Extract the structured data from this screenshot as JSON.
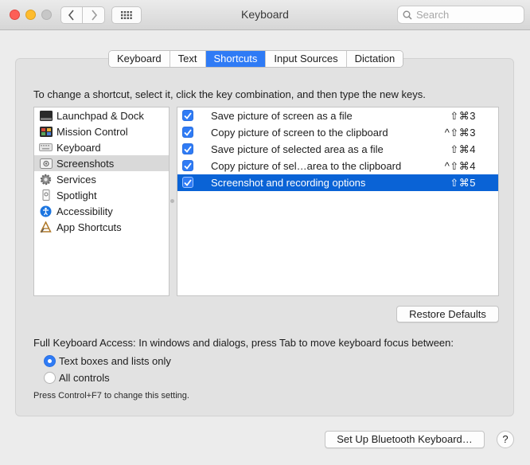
{
  "window": {
    "title": "Keyboard"
  },
  "search": {
    "placeholder": "Search"
  },
  "tabs": [
    {
      "label": "Keyboard"
    },
    {
      "label": "Text"
    },
    {
      "label": "Shortcuts"
    },
    {
      "label": "Input Sources"
    },
    {
      "label": "Dictation"
    }
  ],
  "active_tab": "Shortcuts",
  "instruction": "To change a shortcut, select it, click the key combination, and then type the new keys.",
  "categories": [
    {
      "label": "Launchpad & Dock",
      "icon": "launchpad-dock-icon"
    },
    {
      "label": "Mission Control",
      "icon": "mission-control-icon"
    },
    {
      "label": "Keyboard",
      "icon": "keyboard-icon"
    },
    {
      "label": "Screenshots",
      "icon": "screenshots-icon"
    },
    {
      "label": "Services",
      "icon": "gear-icon"
    },
    {
      "label": "Spotlight",
      "icon": "spotlight-icon"
    },
    {
      "label": "Accessibility",
      "icon": "accessibility-icon"
    },
    {
      "label": "App Shortcuts",
      "icon": "app-shortcuts-icon"
    }
  ],
  "selected_category": "Screenshots",
  "shortcuts": [
    {
      "label": "Save picture of screen as a file",
      "keys": "⇧⌘3",
      "checked": true
    },
    {
      "label": "Copy picture of screen to the clipboard",
      "keys": "^⇧⌘3",
      "checked": true
    },
    {
      "label": "Save picture of selected area as a file",
      "keys": "⇧⌘4",
      "checked": true
    },
    {
      "label": "Copy picture of sel…area to the clipboard",
      "keys": "^⇧⌘4",
      "checked": true
    },
    {
      "label": "Screenshot and recording options",
      "keys": "⇧⌘5",
      "checked": true
    }
  ],
  "selected_shortcut": "Screenshot and recording options",
  "restore_defaults": "Restore Defaults",
  "full_keyboard_access": {
    "label": "Full Keyboard Access: In windows and dialogs, press Tab to move keyboard focus between:",
    "options": [
      {
        "label": "Text boxes and lists only",
        "selected": true
      },
      {
        "label": "All controls",
        "selected": false
      }
    ],
    "note": "Press Control+F7 to change this setting."
  },
  "bluetooth_button": "Set Up Bluetooth Keyboard…",
  "help_button": "?",
  "colors": {
    "accent": "#2f7bf5",
    "selection": "#0a63d6",
    "close": "#fd5f57",
    "minimize": "#febc2e"
  }
}
